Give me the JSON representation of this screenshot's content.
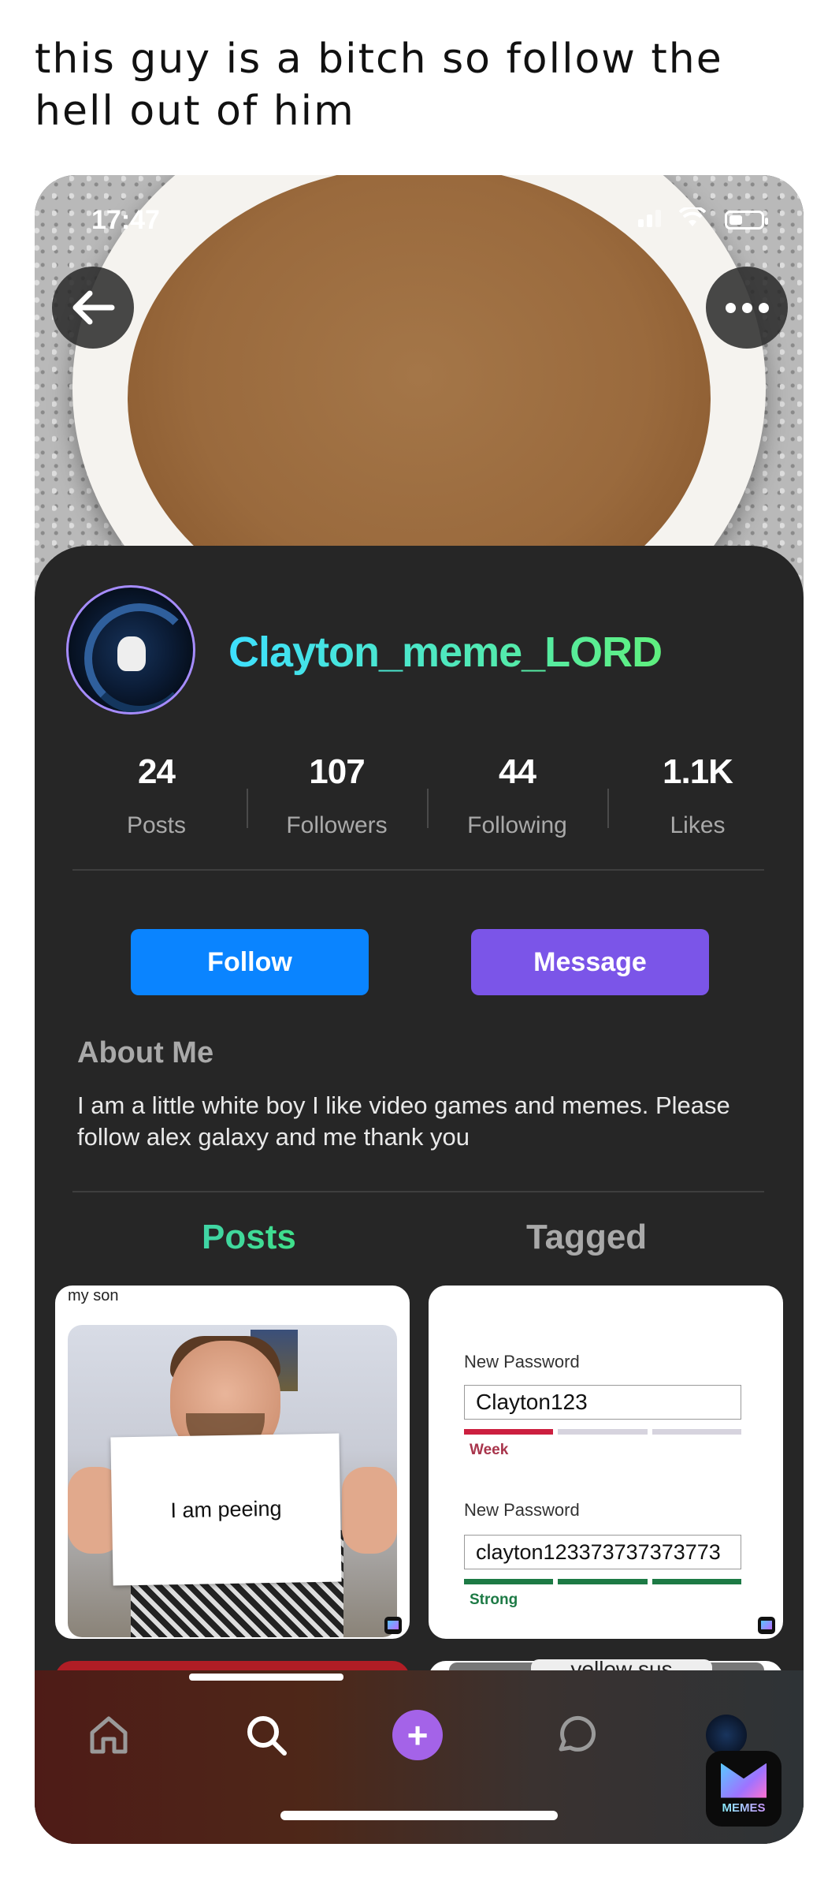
{
  "caption": "this guy is a bitch so follow the hell out of him",
  "status_bar": {
    "time": "17:47"
  },
  "profile": {
    "username": "Clayton_meme_LORD",
    "stats": [
      {
        "value": "24",
        "label": "Posts"
      },
      {
        "value": "107",
        "label": "Followers"
      },
      {
        "value": "44",
        "label": "Following"
      },
      {
        "value": "1.1K",
        "label": "Likes"
      }
    ],
    "follow_label": "Follow",
    "message_label": "Message",
    "about_title": "About Me",
    "about_text": "I am a little white boy I like video games and memes. Please follow alex galaxy and me thank you"
  },
  "tabs": {
    "posts": "Posts",
    "tagged": "Tagged"
  },
  "posts": [
    {
      "caption": "my son",
      "sign_text": "I am peeing"
    },
    {
      "label1": "New Password",
      "value1": "Clayton123",
      "strength1": "Week",
      "label2": "New Password",
      "value2": "clayton123373737373773",
      "strength2": "Strong"
    }
  ],
  "peek_text": "yellow sus",
  "watermark": "MEMES",
  "colors": {
    "follow": "#0a84ff",
    "message": "#7b55e8",
    "username_gradient": [
      "#3ee0ff",
      "#5ff07e"
    ],
    "card_bg": "#262626"
  }
}
